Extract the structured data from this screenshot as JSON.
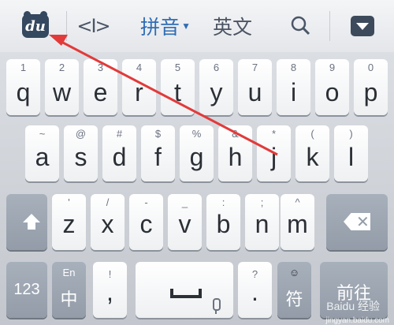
{
  "toolbar": {
    "logo_text": "du",
    "cursor_symbol": "<I>",
    "pinyin_label": "拼音",
    "english_label": "英文",
    "logo_color": "#34485f",
    "active_color": "#2f6db5"
  },
  "keyboard": {
    "row1": [
      {
        "sym": "1",
        "let": "q"
      },
      {
        "sym": "2",
        "let": "w"
      },
      {
        "sym": "3",
        "let": "e"
      },
      {
        "sym": "4",
        "let": "r"
      },
      {
        "sym": "5",
        "let": "t"
      },
      {
        "sym": "6",
        "let": "y"
      },
      {
        "sym": "7",
        "let": "u"
      },
      {
        "sym": "8",
        "let": "i"
      },
      {
        "sym": "9",
        "let": "o"
      },
      {
        "sym": "0",
        "let": "p"
      }
    ],
    "row2": [
      {
        "sym": "~",
        "let": "a"
      },
      {
        "sym": "@",
        "let": "s"
      },
      {
        "sym": "#",
        "let": "d"
      },
      {
        "sym": "$",
        "let": "f"
      },
      {
        "sym": "%",
        "let": "g"
      },
      {
        "sym": "&",
        "let": "h"
      },
      {
        "sym": "*",
        "let": "j"
      },
      {
        "sym": "(",
        "let": "k"
      },
      {
        "sym": ")",
        "let": "l"
      }
    ],
    "row3": [
      {
        "sym": "'",
        "let": "z"
      },
      {
        "sym": "/",
        "let": "x"
      },
      {
        "sym": "-",
        "let": "c"
      },
      {
        "sym": "_",
        "let": "v"
      },
      {
        "sym": ":",
        "let": "b"
      },
      {
        "sym": ";",
        "let": "n"
      },
      {
        "sym": "^",
        "let": "m"
      }
    ],
    "num_label": "123",
    "en_top": "En",
    "en_bottom": "中",
    "comma_sym": "!",
    "comma_let": ",",
    "period_sym": "?",
    "period_let": ".",
    "emoji_sym": "☺",
    "symbol_let": "符",
    "go_label": "前往",
    "accent_color": "#939ca8"
  },
  "watermark": {
    "brand": "Baidu 经验",
    "url": "jingyan.baidu.com"
  }
}
